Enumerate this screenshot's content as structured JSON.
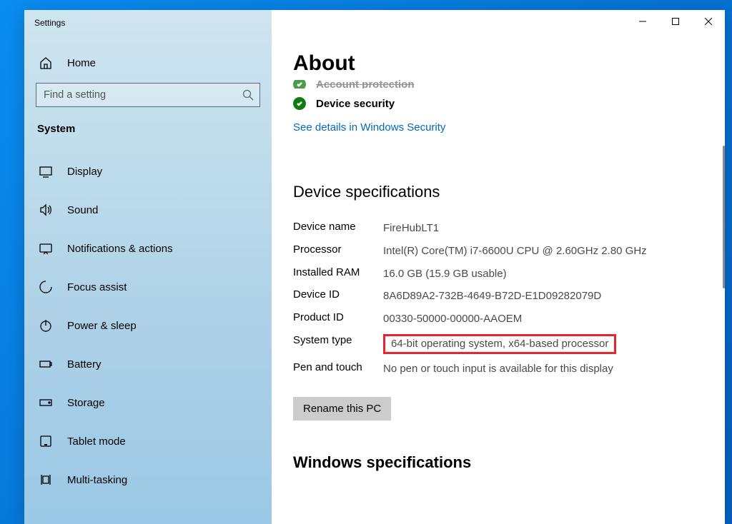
{
  "window": {
    "title": "Settings"
  },
  "sidebar": {
    "home_label": "Home",
    "search_placeholder": "Find a setting",
    "section_label": "System",
    "items": [
      {
        "label": "Display"
      },
      {
        "label": "Sound"
      },
      {
        "label": "Notifications & actions"
      },
      {
        "label": "Focus assist"
      },
      {
        "label": "Power & sleep"
      },
      {
        "label": "Battery"
      },
      {
        "label": "Storage"
      },
      {
        "label": "Tablet mode"
      },
      {
        "label": "Multi-tasking"
      }
    ]
  },
  "main": {
    "title": "About",
    "sec_partial_label": "Account protection",
    "sec_device_label": "Device security",
    "security_link": "See details in Windows Security",
    "spec_header": "Device specifications",
    "specs": {
      "device_name_label": "Device name",
      "device_name_val": "FireHubLT1",
      "processor_label": "Processor",
      "processor_val": "Intel(R) Core(TM) i7-6600U CPU @ 2.60GHz   2.80 GHz",
      "ram_label": "Installed RAM",
      "ram_val": "16.0 GB (15.9 GB usable)",
      "device_id_label": "Device ID",
      "device_id_val": "8A6D89A2-732B-4649-B72D-E1D09282079D",
      "product_id_label": "Product ID",
      "product_id_val": "00330-50000-00000-AAOEM",
      "system_type_label": "System type",
      "system_type_val": "64-bit operating system, x64-based processor",
      "pen_touch_label": "Pen and touch",
      "pen_touch_val": "No pen or touch input is available for this display"
    },
    "rename_btn": "Rename this PC",
    "windows_spec_header": "Windows specifications"
  }
}
